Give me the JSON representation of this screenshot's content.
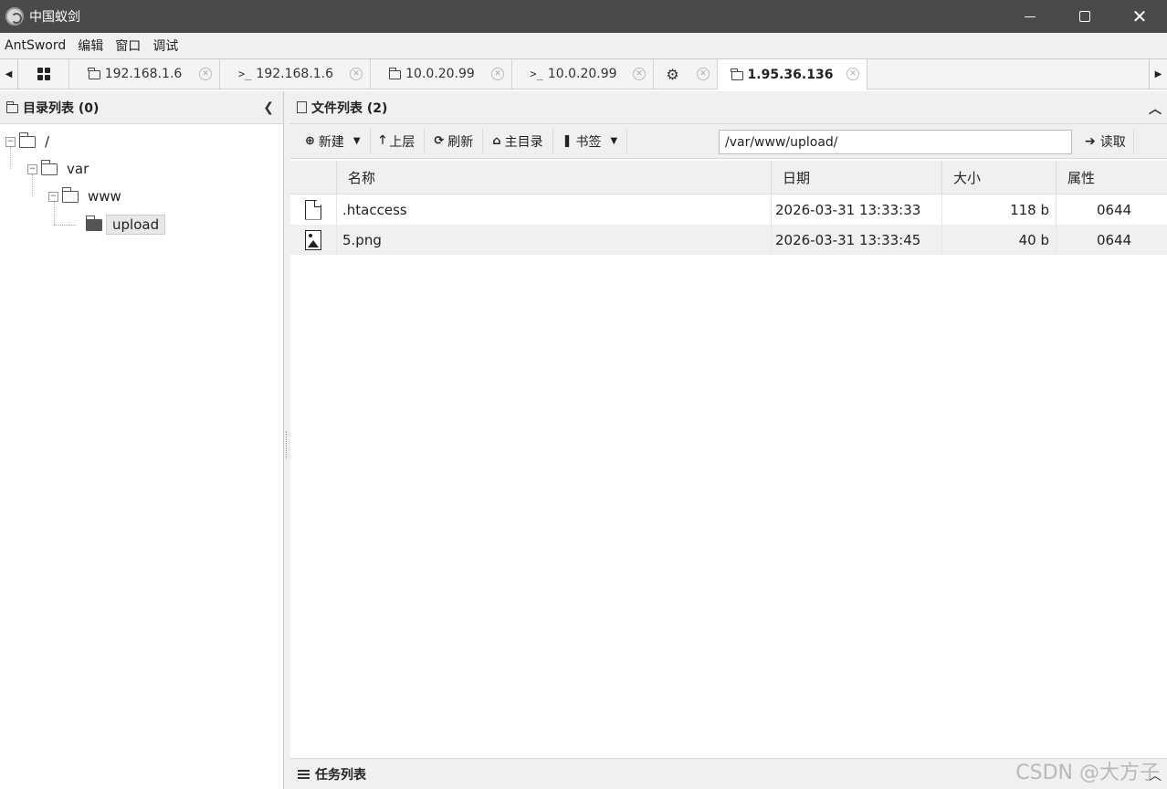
{
  "window": {
    "title": "中国蚁剑"
  },
  "menu": [
    "AntSword",
    "编辑",
    "窗口",
    "调试"
  ],
  "tabs": [
    {
      "label": "192.168.1.6",
      "icon": "folder-icon"
    },
    {
      "label": "192.168.1.6",
      "icon": "terminal-icon",
      "prefix": ">_"
    },
    {
      "label": "10.0.20.99",
      "icon": "folder-icon"
    },
    {
      "label": "10.0.20.99",
      "icon": "terminal-icon",
      "prefix": ">_"
    },
    {
      "label": "",
      "icon": "gear-icon"
    },
    {
      "label": "1.95.36.136",
      "icon": "folder-icon",
      "active": true
    }
  ],
  "left_panel": {
    "title": "目录列表 (0)",
    "tree": [
      "/",
      "var",
      "www",
      "upload"
    ]
  },
  "right_panel": {
    "title": "文件列表 (2)",
    "toolbar": {
      "new_label": "新建",
      "up_label": "上层",
      "refresh_label": "刷新",
      "home_label": "主目录",
      "bookmark_label": "书签",
      "path_value": "/var/www/upload/",
      "read_label": "读取"
    },
    "columns": [
      "名称",
      "日期",
      "大小",
      "属性"
    ],
    "rows": [
      {
        "name": ".htaccess",
        "date": "2026-03-31 13:33:33",
        "size": "118 b",
        "attr": "0644",
        "icon": "file-icon"
      },
      {
        "name": "5.png",
        "date": "2026-03-31 13:33:45",
        "size": "40 b",
        "attr": "0644",
        "icon": "image-file-icon"
      }
    ]
  },
  "task_panel": {
    "title": "任务列表"
  },
  "watermark": "CSDN @大方子"
}
